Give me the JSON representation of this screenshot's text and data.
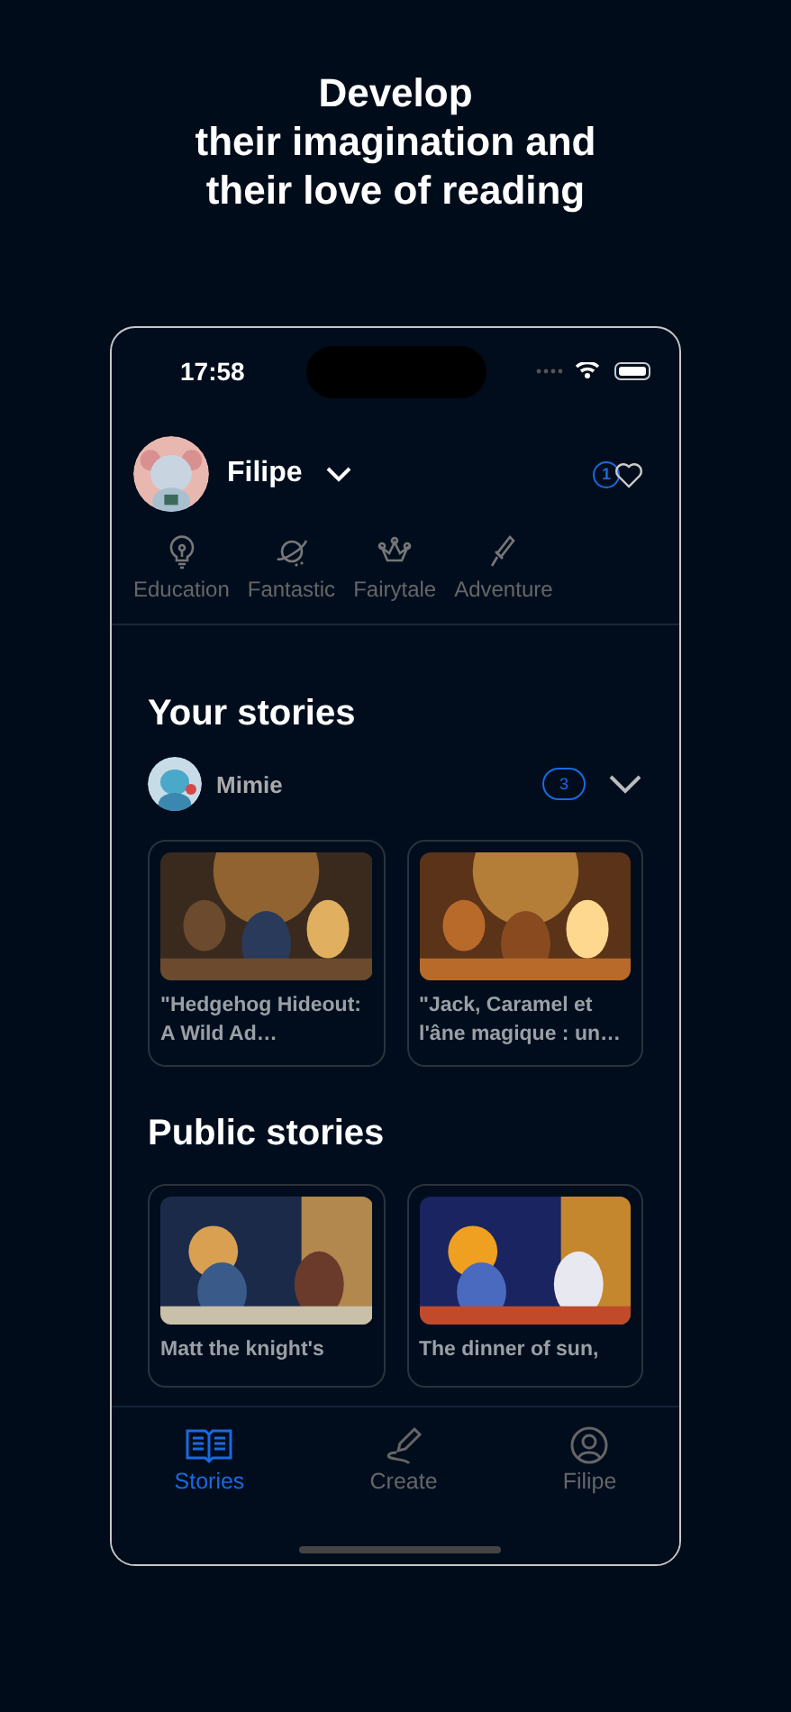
{
  "headline": [
    "Develop",
    "their imagination and",
    "their love of reading"
  ],
  "status_bar": {
    "time": "17:58"
  },
  "profile": {
    "name": "Filipe",
    "favorites_count": "1"
  },
  "categories": [
    {
      "label": "Education",
      "kind": "bulb"
    },
    {
      "label": "Fantastic",
      "kind": "planet"
    },
    {
      "label": "Fairytale",
      "kind": "crown"
    },
    {
      "label": "Adventure",
      "kind": "sword"
    }
  ],
  "your_stories": {
    "title": "Your stories",
    "child": {
      "name": "Mimie",
      "count": "3"
    },
    "stories": [
      {
        "title": "\"Hedgehog Hideout: A Wild Ad…",
        "kind": "picture"
      },
      {
        "title": "\"Jack, Caramel et l'âne magique : un…",
        "kind": "picture"
      }
    ]
  },
  "public_stories": {
    "title": "Public stories",
    "stories": [
      {
        "title": "Matt the knight's",
        "kind": "picture"
      },
      {
        "title": "The dinner of sun,",
        "kind": "picture"
      }
    ]
  },
  "tabs": [
    {
      "label": "Stories",
      "kind": "book",
      "selected": true
    },
    {
      "label": "Create",
      "kind": "pen",
      "selected": false
    },
    {
      "label": "Filipe",
      "kind": "person",
      "selected": false
    }
  ]
}
